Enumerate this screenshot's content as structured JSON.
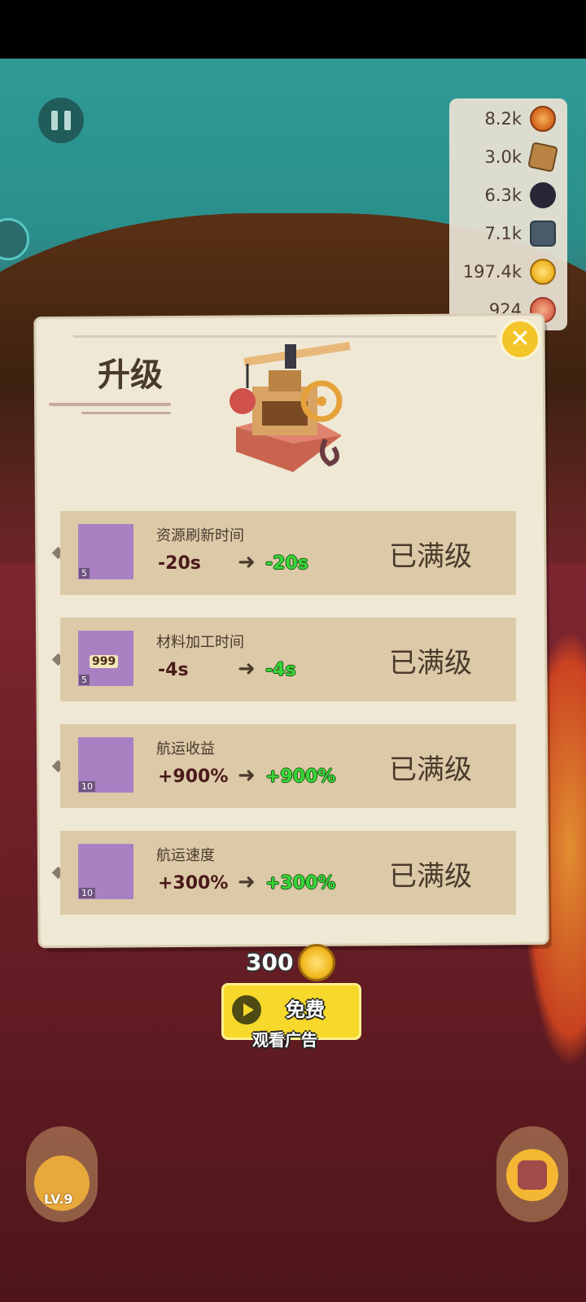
{
  "resources": [
    {
      "value": "8.2k",
      "icon": "wood-icon"
    },
    {
      "value": "3.0k",
      "icon": "crate-icon"
    },
    {
      "value": "6.3k",
      "icon": "bomb-icon"
    },
    {
      "value": "7.1k",
      "icon": "iron-icon"
    },
    {
      "value": "197.4k",
      "icon": "coin-icon"
    },
    {
      "value": "924",
      "icon": "food-icon"
    }
  ],
  "dialog": {
    "title": "升级",
    "rows": [
      {
        "name": "资源刷新时间",
        "level": "5",
        "current": "-20s",
        "next": "-20s",
        "status": "已满级",
        "icon": "coral-icon"
      },
      {
        "name": "材料加工时间",
        "level": "5",
        "current": "-4s",
        "next": "-4s",
        "status": "已满级",
        "icon": "wood-999-icon",
        "badge": "999"
      },
      {
        "name": "航运收益",
        "level": "10",
        "current": "+900%",
        "next": "+900%",
        "status": "已满级",
        "icon": "gold-sack-icon"
      },
      {
        "name": "航运速度",
        "level": "10",
        "current": "+300%",
        "next": "+300%",
        "status": "已满级",
        "icon": "sailboat-icon"
      }
    ],
    "arrow": "➜"
  },
  "ad": {
    "coins": "300",
    "free_label": "免费",
    "watch_label": "观看广告"
  },
  "bottom": {
    "level_label": "LV.9"
  },
  "colors": {
    "accent_yellow": "#f6d92b",
    "green_value": "#37d63a",
    "panel_bg": "#efe8d4",
    "row_bg": "#dcc9a8"
  }
}
